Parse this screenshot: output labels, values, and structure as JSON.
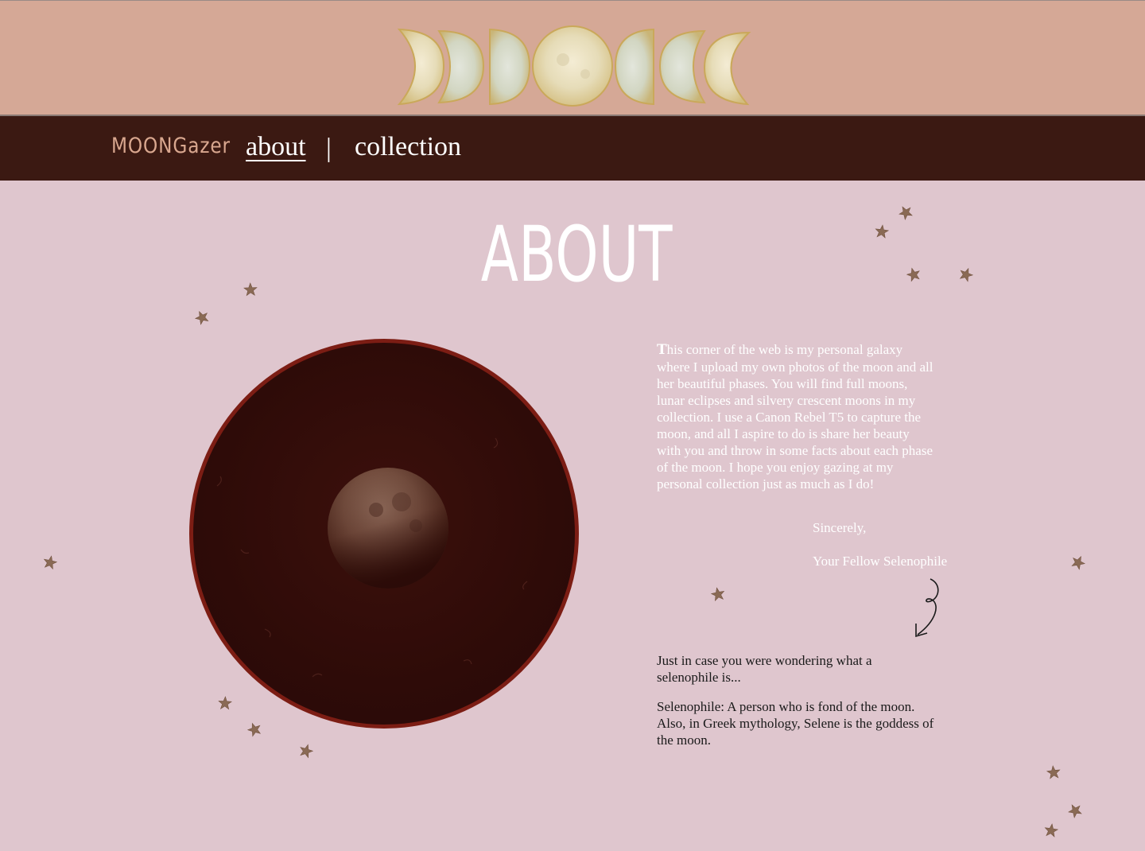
{
  "nav": {
    "brand": "MOONGazer",
    "about_label": "about",
    "separator": "|",
    "collection_label": "collection"
  },
  "page": {
    "title": "ABOUT"
  },
  "about": {
    "paragraph_first_letter": "T",
    "paragraph_rest": "his corner of the web is my personal galaxy where I upload my own photos of the moon and all her beautiful phases. You will find full moons, lunar eclipses and silvery crescent moons in my collection. I use a Canon Rebel T5 to capture the moon, and all I aspire to do is share her beauty with you and throw in some facts about each phase of the moon. I hope you enjoy gazing at my personal collection just as much as I do!",
    "sincerely": "Sincerely,",
    "signature": "Your Fellow Selenophile"
  },
  "definition": {
    "intro": "Just in case you were wondering what a selenophile is...",
    "text": "Selenophile: A person who is fond of the moon. Also, in Greek mythology, Selene is the goddess of the moon."
  },
  "icons": {
    "banner": "moon-phases-icon",
    "photo": "eclipse-moon-photo",
    "arrow": "curly-arrow-icon",
    "star": "star-icon"
  },
  "colors": {
    "banner": "#d5a896",
    "nav": "#3b1912",
    "background": "#dfc6ce",
    "brand": "#d9a78f",
    "frame": "#7c1d14",
    "star": "#8a6a55"
  }
}
